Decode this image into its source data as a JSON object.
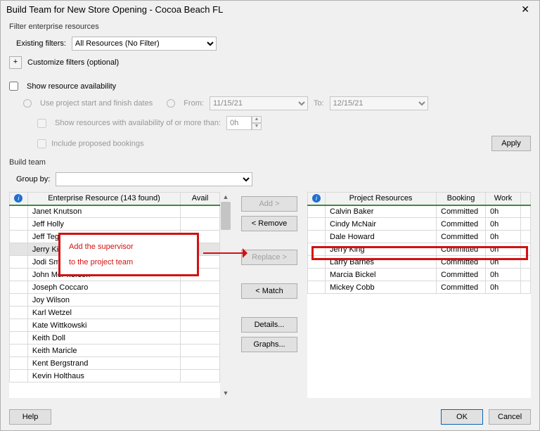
{
  "window": {
    "title": "Build Team for New Store Opening - Cocoa Beach FL"
  },
  "filter": {
    "section_label": "Filter enterprise resources",
    "existing_label": "Existing filters:",
    "existing_value": "All Resources (No Filter)",
    "customize_label": "Customize filters (optional)"
  },
  "availability": {
    "show_label": "Show resource availability",
    "use_dates_label": "Use project start and finish dates",
    "from_label": "From:",
    "from_value": "11/15/21",
    "to_label": "To:",
    "to_value": "12/15/21",
    "show_avail_more_label": "Show resources with availability of or more than:",
    "hours_value": "0h",
    "include_proposed_label": "Include proposed bookings",
    "apply_label": "Apply"
  },
  "buildteam": {
    "section_label": "Build team",
    "groupby_label": "Group by:",
    "groupby_value": ""
  },
  "left": {
    "header_resource": "Enterprise Resource (143 found)",
    "header_avail": "Avail",
    "rows": [
      {
        "name": "Janet Knutson"
      },
      {
        "name": "Jeff Holly"
      },
      {
        "name": "Jeff Teglovic"
      },
      {
        "name": "Jerry King",
        "selected": true
      },
      {
        "name": "Jodi Smith"
      },
      {
        "name": "John McPherson"
      },
      {
        "name": "Joseph Coccaro"
      },
      {
        "name": "Joy Wilson"
      },
      {
        "name": "Karl Wetzel"
      },
      {
        "name": "Kate Wittkowski"
      },
      {
        "name": "Keith Doll"
      },
      {
        "name": "Keith Maricle"
      },
      {
        "name": "Kent Bergstrand"
      },
      {
        "name": "Kevin Holthaus"
      }
    ]
  },
  "mid": {
    "add": "Add >",
    "remove": "< Remove",
    "replace": "Replace >",
    "match": "< Match",
    "details": "Details...",
    "graphs": "Graphs..."
  },
  "right": {
    "header_resource": "Project Resources",
    "header_booking": "Booking",
    "header_work": "Work",
    "rows": [
      {
        "name": "Calvin Baker",
        "booking": "Committed",
        "work": "0h"
      },
      {
        "name": "Cindy McNair",
        "booking": "Committed",
        "work": "0h"
      },
      {
        "name": "Dale Howard",
        "booking": "Committed",
        "work": "0h",
        "highlight": true
      },
      {
        "name": "Jerry King",
        "booking": "Committed",
        "work": "0h"
      },
      {
        "name": "Larry Barnes",
        "booking": "Committed",
        "work": "0h"
      },
      {
        "name": "Marcia Bickel",
        "booking": "Committed",
        "work": "0h"
      },
      {
        "name": "Mickey Cobb",
        "booking": "Committed",
        "work": "0h"
      }
    ]
  },
  "footer": {
    "help": "Help",
    "ok": "OK",
    "cancel": "Cancel"
  },
  "callout": {
    "line1": "Add the supervisor",
    "line2": "to the project team"
  }
}
